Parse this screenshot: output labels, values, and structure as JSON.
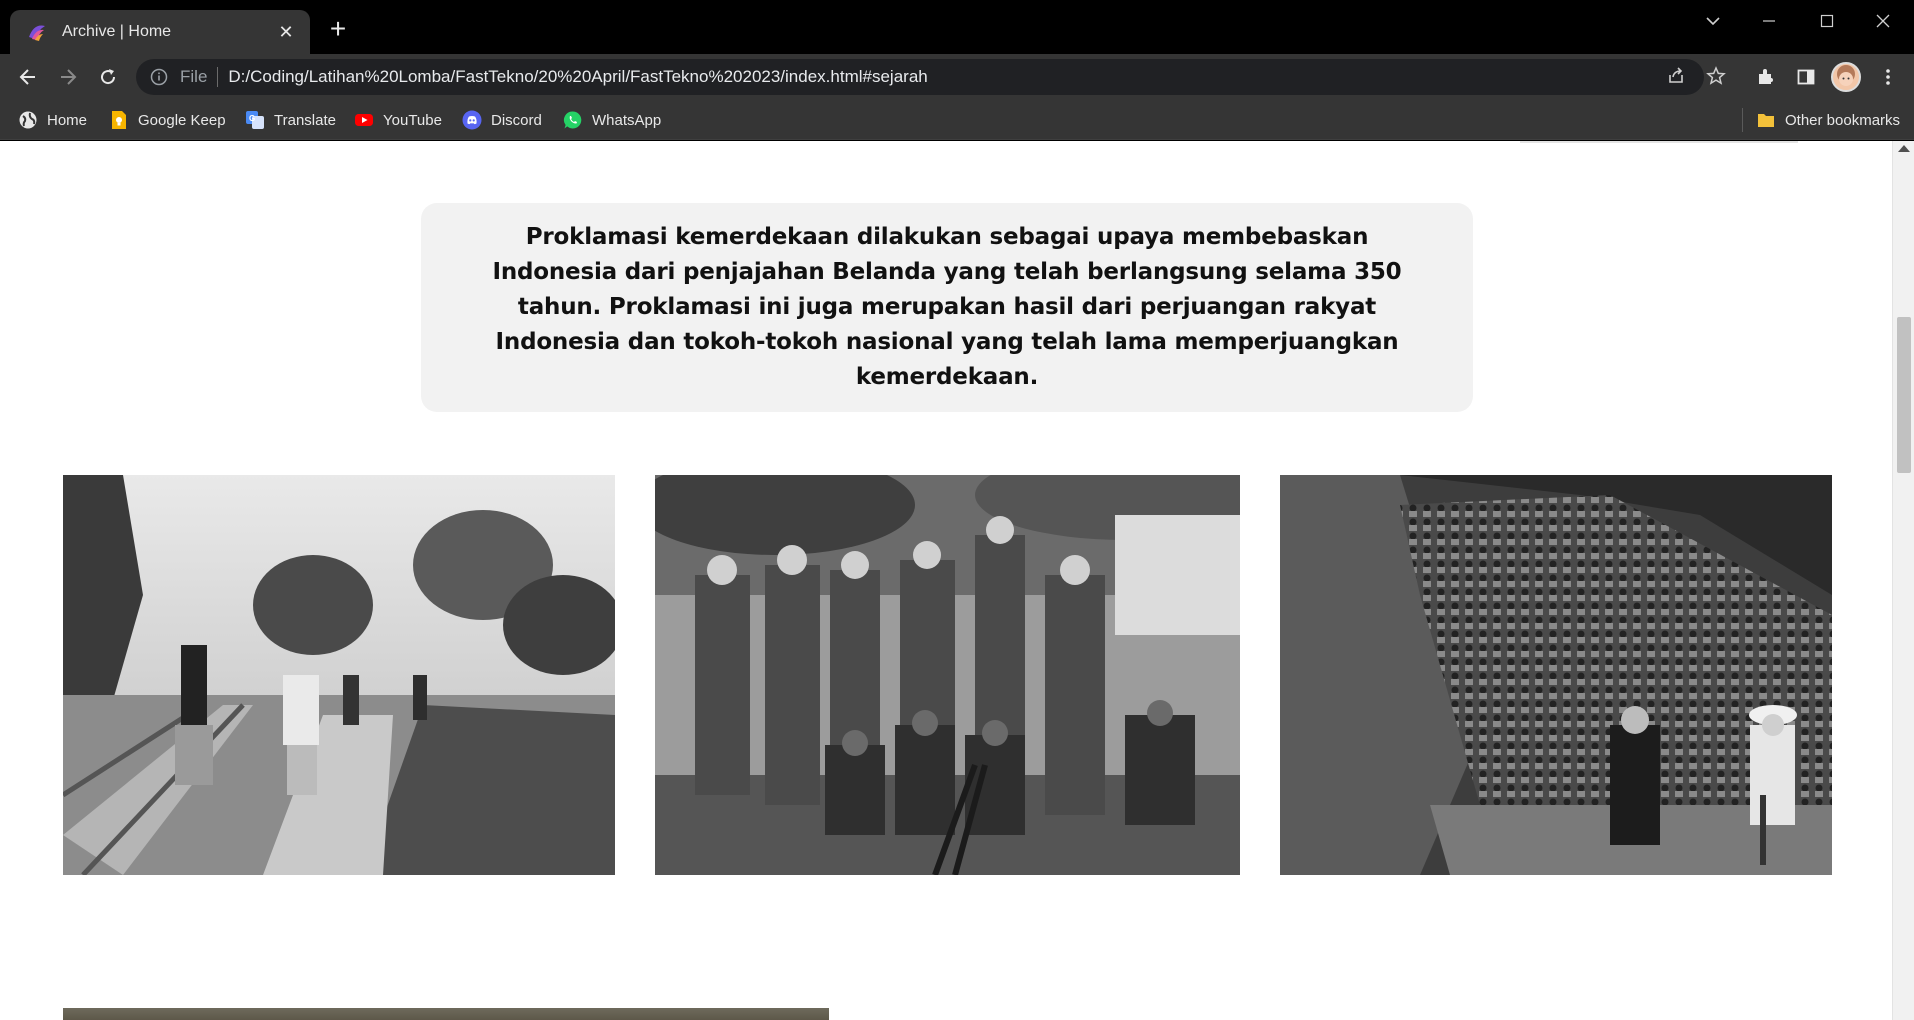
{
  "browser": {
    "tab_title": "Archive | Home",
    "new_tab_symbol": "+",
    "close_symbol": "✕",
    "omnibox": {
      "scheme_label": "File",
      "url": "D:/Coding/Latihan%20Lomba/FastTekno/20%20April/FastTekno%202023/index.html#sejarah"
    },
    "bookmarks": [
      {
        "label": "Home",
        "icon": "globe-icon"
      },
      {
        "label": "Google Keep",
        "icon": "keep-icon"
      },
      {
        "label": "Translate",
        "icon": "translate-icon"
      },
      {
        "label": "YouTube",
        "icon": "youtube-icon"
      },
      {
        "label": "Discord",
        "icon": "discord-icon"
      },
      {
        "label": "WhatsApp",
        "icon": "whatsapp-icon"
      }
    ],
    "other_bookmarks": "Other bookmarks"
  },
  "page": {
    "quote_text": "Proklamasi kemerdekaan dilakukan sebagai upaya membebaskan Indonesia dari penjajahan Belanda yang telah berlangsung selama 350 tahun. Proklamasi ini juga merupakan hasil dari perjuangan rakyat Indonesia dan tokoh-tokoh nasional yang telah lama memperjuangkan kemerdekaan.",
    "photos": [
      {
        "name": "historical-photo-railway-workers",
        "tone": "#8a8a8a"
      },
      {
        "name": "historical-photo-soldiers-prisoners",
        "tone": "#6f6f6f"
      },
      {
        "name": "historical-photo-crowd-gathering",
        "tone": "#5a5a5a"
      }
    ]
  },
  "colors": {
    "tab_bar": "#000000",
    "toolbar": "#353535",
    "omnibox": "#202124",
    "quote_box": "#f2f2f2",
    "page_bg": "#ffffff"
  }
}
